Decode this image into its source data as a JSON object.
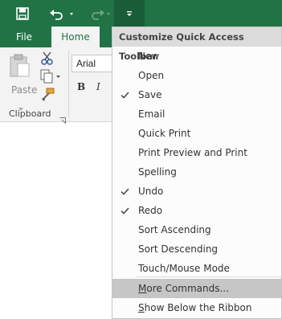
{
  "qat": {
    "save_icon": "floppy-disk-icon",
    "undo_icon": "undo-arrow-icon",
    "redo_icon": "redo-arrow-icon",
    "customize_icon": "customize-dropdown-icon"
  },
  "tabs": {
    "file": "File",
    "home": "Home"
  },
  "ribbon": {
    "paste_label": "Paste",
    "clipboard_label": "Clipboard",
    "font_name": "Arial",
    "bold": "B",
    "italic": "I"
  },
  "menu": {
    "header": "Customize Quick Access Toolbar",
    "items": [
      {
        "label": "New",
        "checked": false
      },
      {
        "label": "Open",
        "checked": false
      },
      {
        "label": "Save",
        "checked": true
      },
      {
        "label": "Email",
        "checked": false
      },
      {
        "label": "Quick Print",
        "checked": false
      },
      {
        "label": "Print Preview and Print",
        "checked": false
      },
      {
        "label": "Spelling",
        "checked": false
      },
      {
        "label": "Undo",
        "checked": true
      },
      {
        "label": "Redo",
        "checked": true
      },
      {
        "label": "Sort Ascending",
        "checked": false
      },
      {
        "label": "Sort Descending",
        "checked": false
      },
      {
        "label": "Touch/Mouse Mode",
        "checked": false
      }
    ],
    "more_commands": {
      "underline": "M",
      "rest": "ore Commands..."
    },
    "show_below": {
      "underline": "S",
      "rest": "how Below the Ribbon"
    }
  },
  "colors": {
    "accent": "#217346",
    "menu_header_bg": "#dcdcdc",
    "highlight": "#c6c6c6"
  }
}
